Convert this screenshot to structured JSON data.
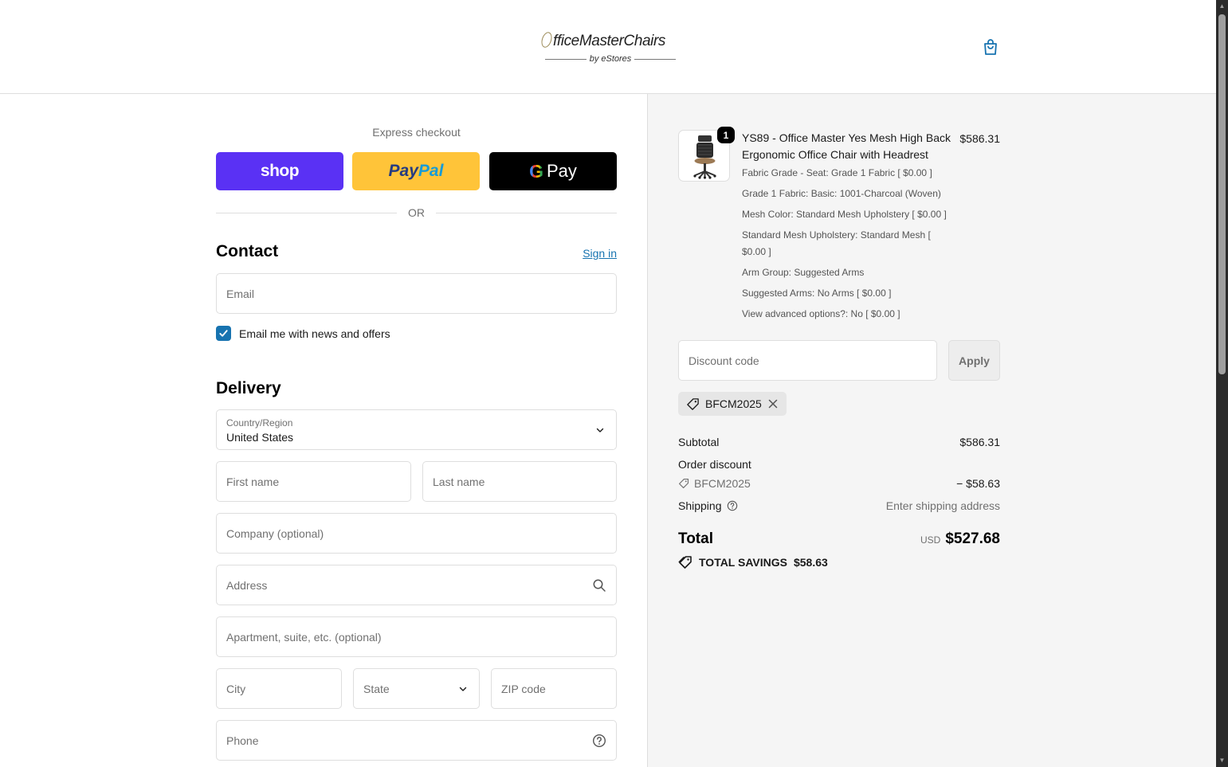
{
  "header": {
    "logo_main": "fficeMasterChairs",
    "logo_sub": "by eStores",
    "cart_icon": "shopping-bag-icon"
  },
  "express": {
    "label": "Express checkout",
    "shop_label": "shop",
    "paypal_label_1": "Pay",
    "paypal_label_2": "Pal",
    "gpay_label": "Pay",
    "or_label": "OR"
  },
  "contact": {
    "title": "Contact",
    "signin_label": "Sign in",
    "email_placeholder": "Email",
    "newsletter_label": "Email me with news and offers",
    "newsletter_checked": true
  },
  "delivery": {
    "title": "Delivery",
    "country_label": "Country/Region",
    "country_value": "United States",
    "first_name_placeholder": "First name",
    "last_name_placeholder": "Last name",
    "company_placeholder": "Company (optional)",
    "address_placeholder": "Address",
    "apartment_placeholder": "Apartment, suite, etc. (optional)",
    "city_placeholder": "City",
    "state_placeholder": "State",
    "zip_placeholder": "ZIP code",
    "phone_placeholder": "Phone"
  },
  "order": {
    "item": {
      "quantity": "1",
      "name": "YS89 - Office Master Yes Mesh High Back Ergonomic Office Chair with Headrest",
      "price": "$586.31",
      "options": [
        "Fabric Grade - Seat: Grade 1 Fabric [ $0.00 ]",
        "Grade 1 Fabric: Basic: 1001-Charcoal (Woven)",
        "Mesh Color: Standard Mesh Upholstery [ $0.00 ]",
        "Standard Mesh Upholstery: Standard Mesh [ $0.00 ]",
        "Arm Group: Suggested Arms",
        "Suggested Arms: No Arms [ $0.00 ]",
        "View advanced options?: No [ $0.00 ]"
      ]
    },
    "discount_placeholder": "Discount code",
    "apply_label": "Apply",
    "applied_code": "BFCM2025",
    "subtotal_label": "Subtotal",
    "subtotal_value": "$586.31",
    "order_discount_label": "Order discount",
    "discount_code": "BFCM2025",
    "discount_value": "− $58.63",
    "shipping_label": "Shipping",
    "shipping_value": "Enter shipping address",
    "total_label": "Total",
    "total_currency": "USD",
    "total_value": "$527.68",
    "savings_label": "TOTAL SAVINGS",
    "savings_value": "$58.63"
  },
  "colors": {
    "accent_blue": "#1773b0",
    "shop_purple": "#5a31f4",
    "paypal_yellow": "#ffc439",
    "summary_bg": "#f5f5f5"
  }
}
